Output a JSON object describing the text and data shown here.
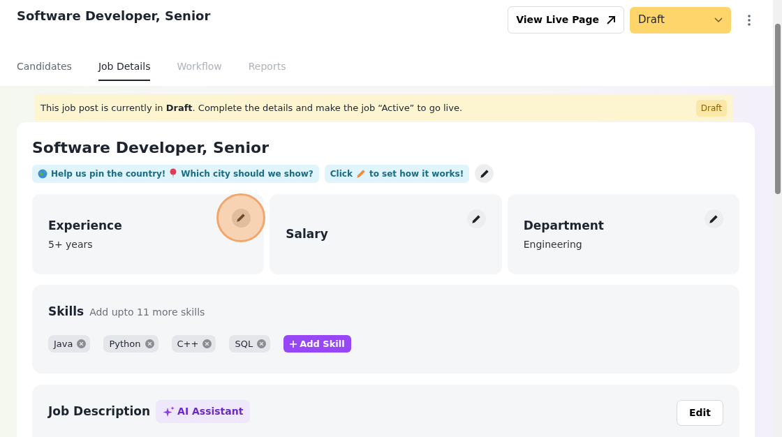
{
  "header": {
    "title": "Software Developer, Senior",
    "view_button": "View Live Page",
    "status_select": {
      "value": "Draft"
    }
  },
  "tabs": [
    {
      "label": "Candidates",
      "selected": false,
      "disabled": false
    },
    {
      "label": "Job Details",
      "selected": true,
      "disabled": false
    },
    {
      "label": "Workflow",
      "selected": false,
      "disabled": true
    },
    {
      "label": "Reports",
      "selected": false,
      "disabled": true
    }
  ],
  "banner": {
    "message": "This job post is currently in **Draft**. Complete the details and make the job “Active” to go live.",
    "badge": "Draft"
  },
  "job": {
    "title": "Software Developer, Senior",
    "hints": [
      {
        "kind": "location",
        "texts": [
          "Help us pin the country!",
          "Which city should we show?"
        ]
      },
      {
        "kind": "instruction",
        "texts": [
          "Click",
          "to set how it works!"
        ]
      }
    ],
    "fields": [
      {
        "label": "Experience",
        "value": "5+ years",
        "highlighted": true
      },
      {
        "label": "Salary",
        "highlighted": false
      },
      {
        "label": "Department",
        "value": "Engineering",
        "highlighted": false
      }
    ],
    "skills": {
      "title": "Skills",
      "hint": "Add upto 11 more skills",
      "items": [
        "Java",
        "Python",
        "C++",
        "SQL"
      ],
      "add_button": "Add Skill"
    },
    "description": {
      "title": "Job Description",
      "ai_button": "AI Assistant",
      "edit_button": "Edit"
    }
  }
}
